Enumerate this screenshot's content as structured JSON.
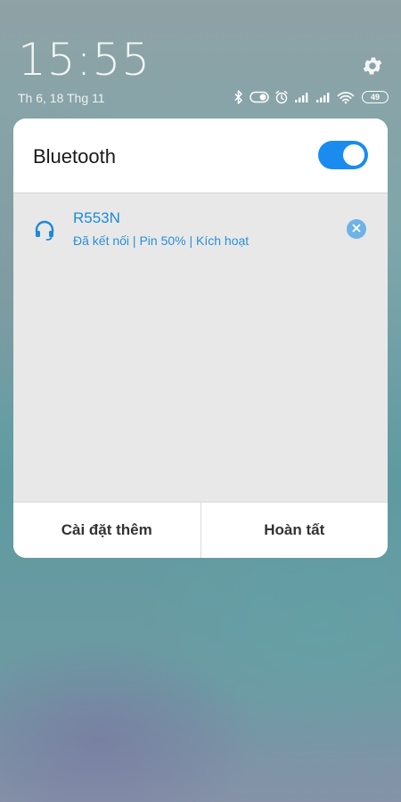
{
  "status_bar": {
    "time": "15:55",
    "date": "Th 6, 18 Thg 11",
    "battery": "49",
    "icons": [
      "bluetooth-icon",
      "toggle-icon",
      "alarm-icon",
      "signal-icon",
      "signal-icon",
      "wifi-icon",
      "battery-icon"
    ],
    "settings_icon": "gear-icon"
  },
  "bluetooth_panel": {
    "title": "Bluetooth",
    "enabled": true,
    "accent_color": "#1a8cf0",
    "devices": [
      {
        "name": "R553N",
        "status": "Đã kết nối | Pin 50% | Kích hoạt",
        "icon": "headset-icon"
      }
    ],
    "buttons": {
      "more_settings": "Cài đặt thêm",
      "done": "Hoàn tất"
    }
  }
}
